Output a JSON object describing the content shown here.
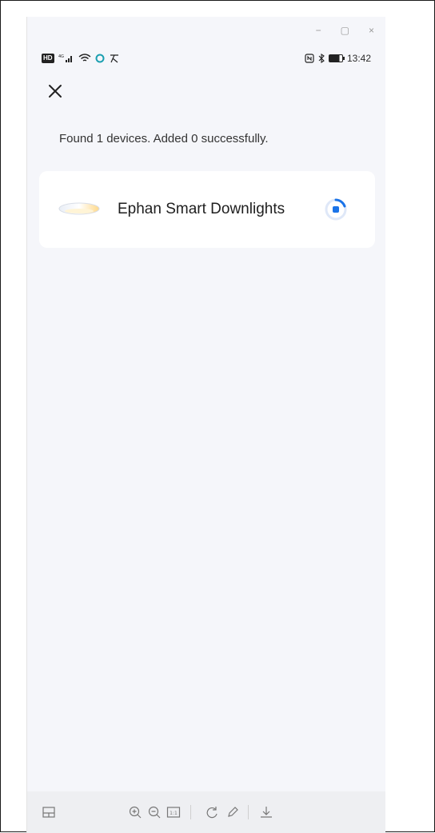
{
  "window": {
    "minimize": "−",
    "restore": "▢",
    "close": "×"
  },
  "status_bar": {
    "hd": "HD",
    "network": "4G",
    "time": "13:42"
  },
  "message": "Found 1 devices. Added 0 successfully.",
  "device": {
    "name": "Ephan Smart Downlights"
  },
  "colors": {
    "accent": "#1a73e8",
    "background": "#f5f6fa",
    "card": "#ffffff"
  },
  "icons": [
    "close-icon",
    "ceiling-light-icon",
    "loading-spinner-icon",
    "layout-icon",
    "zoom-in-icon",
    "zoom-out-icon",
    "actual-size-icon",
    "rotate-icon",
    "edit-icon",
    "download-icon"
  ],
  "toolbar": {
    "actual_size_label": "1:1"
  }
}
